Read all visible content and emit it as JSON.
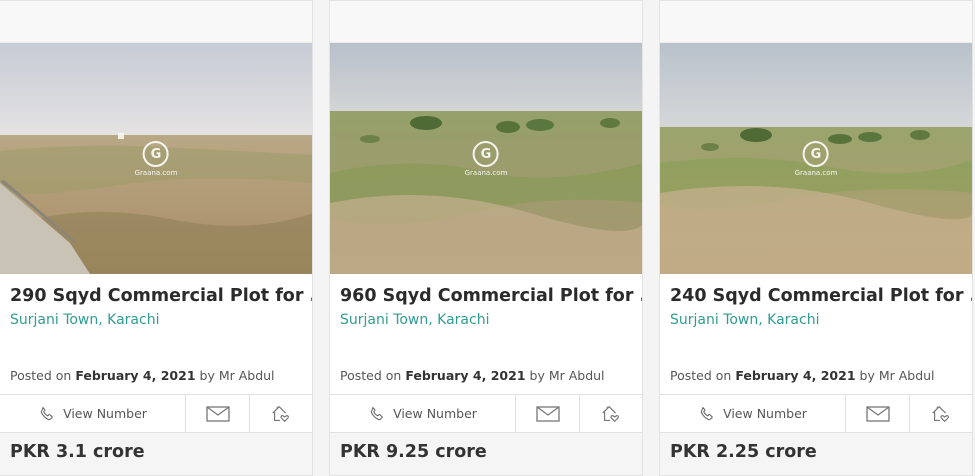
{
  "listings": [
    {
      "title": "290 Sqyd Commercial Plot for ...",
      "location": "Surjani Town, Karachi",
      "posted_prefix": "Posted on",
      "posted_date": "February 4, 2021",
      "posted_by": "by Mr Abdul",
      "view_number_label": "View Number",
      "price": "PKR 3.1 crore",
      "watermark": "Graana.com"
    },
    {
      "title": "960 Sqyd Commercial Plot for ...",
      "location": "Surjani Town, Karachi",
      "posted_prefix": "Posted on",
      "posted_date": "February 4, 2021",
      "posted_by": "by Mr Abdul",
      "view_number_label": "View Number",
      "price": "PKR 9.25 crore",
      "watermark": "Graana.com"
    },
    {
      "title": "240 Sqyd Commercial Plot for ...",
      "location": "Surjani Town, Karachi",
      "posted_prefix": "Posted on",
      "posted_date": "February 4, 2021",
      "posted_by": "by Mr Abdul",
      "view_number_label": "View Number",
      "price": "PKR 2.25 crore",
      "watermark": "Graana.com"
    }
  ],
  "icons": {
    "phone": "phone-icon",
    "mail": "mail-icon",
    "favorite": "house-heart-icon"
  },
  "colors": {
    "location": "#2f9c93",
    "title": "#2b2b2b",
    "price_bg": "#f5f5f5"
  }
}
